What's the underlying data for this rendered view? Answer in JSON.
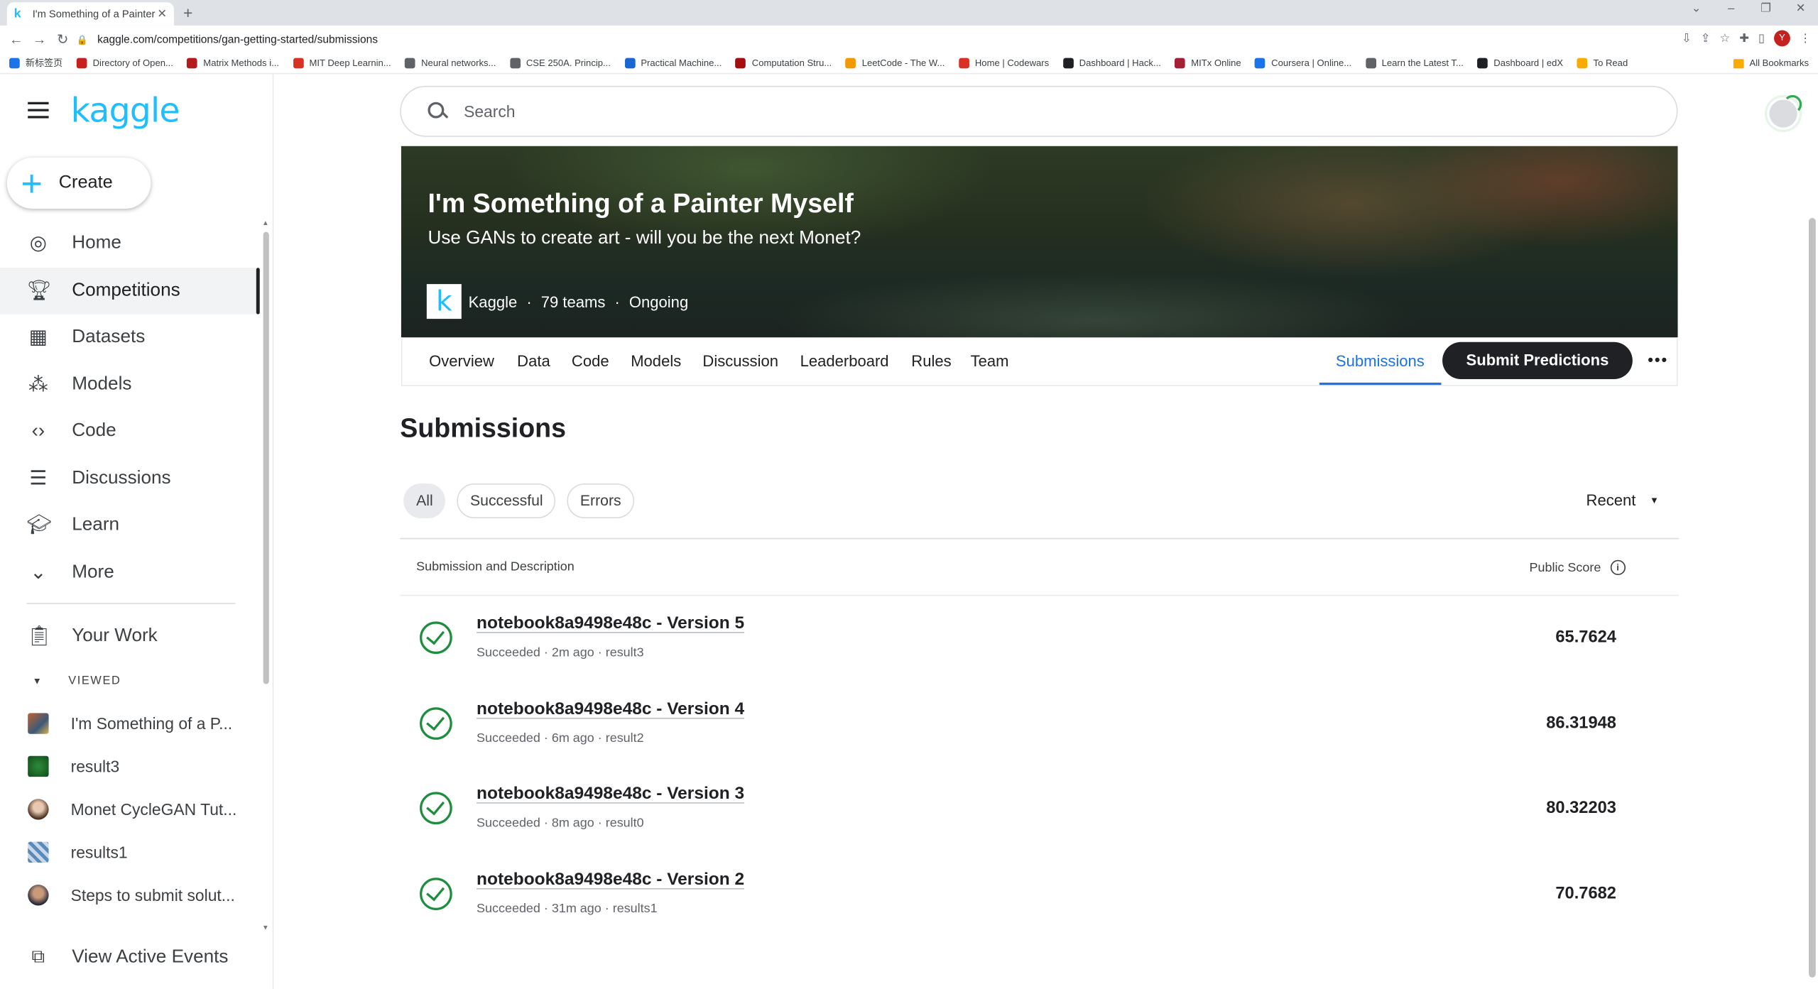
{
  "browser": {
    "tab_title": "I'm Something of a Painter M",
    "url": "kaggle.com/competitions/gan-getting-started/submissions",
    "bookmarks": [
      "新标签页",
      "Directory of Open...",
      "Matrix Methods i...",
      "MIT Deep Learnin...",
      "Neural networks...",
      "CSE 250A. Princip...",
      "Practical Machine...",
      "Computation Stru...",
      "LeetCode - The W...",
      "Home | Codewars",
      "Dashboard | Hack...",
      "MITx Online",
      "Coursera | Online...",
      "Learn the Latest T...",
      "Dashboard | edX",
      "To Read"
    ],
    "all_bookmarks": "All Bookmarks",
    "profile_initial": "Y"
  },
  "sidebar": {
    "logo": "kaggle",
    "create_label": "Create",
    "nav": [
      {
        "label": "Home",
        "icon": "compass-icon"
      },
      {
        "label": "Competitions",
        "icon": "trophy-icon"
      },
      {
        "label": "Datasets",
        "icon": "table-icon"
      },
      {
        "label": "Models",
        "icon": "models-icon"
      },
      {
        "label": "Code",
        "icon": "code-icon"
      },
      {
        "label": "Discussions",
        "icon": "discussion-icon"
      },
      {
        "label": "Learn",
        "icon": "school-icon"
      },
      {
        "label": "More",
        "icon": "chevron-down-icon"
      }
    ],
    "your_work": "Your Work",
    "viewed_header": "VIEWED",
    "viewed": [
      "I'm Something of a P...",
      "result3",
      "Monet CycleGAN Tut...",
      "results1",
      "Steps to submit solut..."
    ],
    "active_events": "View Active Events"
  },
  "search": {
    "placeholder": "Search"
  },
  "banner": {
    "title": "I'm Something of a Painter Myself",
    "subtitle": "Use GANs to create art - will you be the next Monet?",
    "host": "Kaggle",
    "teams": "79 teams",
    "status": "Ongoing"
  },
  "tabs": {
    "items": [
      "Overview",
      "Data",
      "Code",
      "Models",
      "Discussion",
      "Leaderboard",
      "Rules",
      "Team"
    ],
    "selected": "Submissions",
    "submit": "Submit Predictions"
  },
  "page": {
    "title": "Submissions",
    "filters": [
      "All",
      "Successful",
      "Errors"
    ],
    "sort": "Recent",
    "col_submission": "Submission and Description",
    "col_score": "Public Score"
  },
  "submissions": [
    {
      "name": "notebook8a9498e48c - Version 5",
      "meta": "Succeeded · 2m ago · result3",
      "score": "65.7624"
    },
    {
      "name": "notebook8a9498e48c - Version 4",
      "meta": "Succeeded · 6m ago · result2",
      "score": "86.31948"
    },
    {
      "name": "notebook8a9498e48c - Version 3",
      "meta": "Succeeded · 8m ago · result0",
      "score": "80.32203"
    },
    {
      "name": "notebook8a9498e48c - Version 2",
      "meta": "Succeeded · 31m ago · results1",
      "score": "70.7682"
    }
  ],
  "colors": {
    "kaggle_blue": "#20beff",
    "success_green": "#1e8e3e",
    "link_blue": "#1a73e8"
  }
}
